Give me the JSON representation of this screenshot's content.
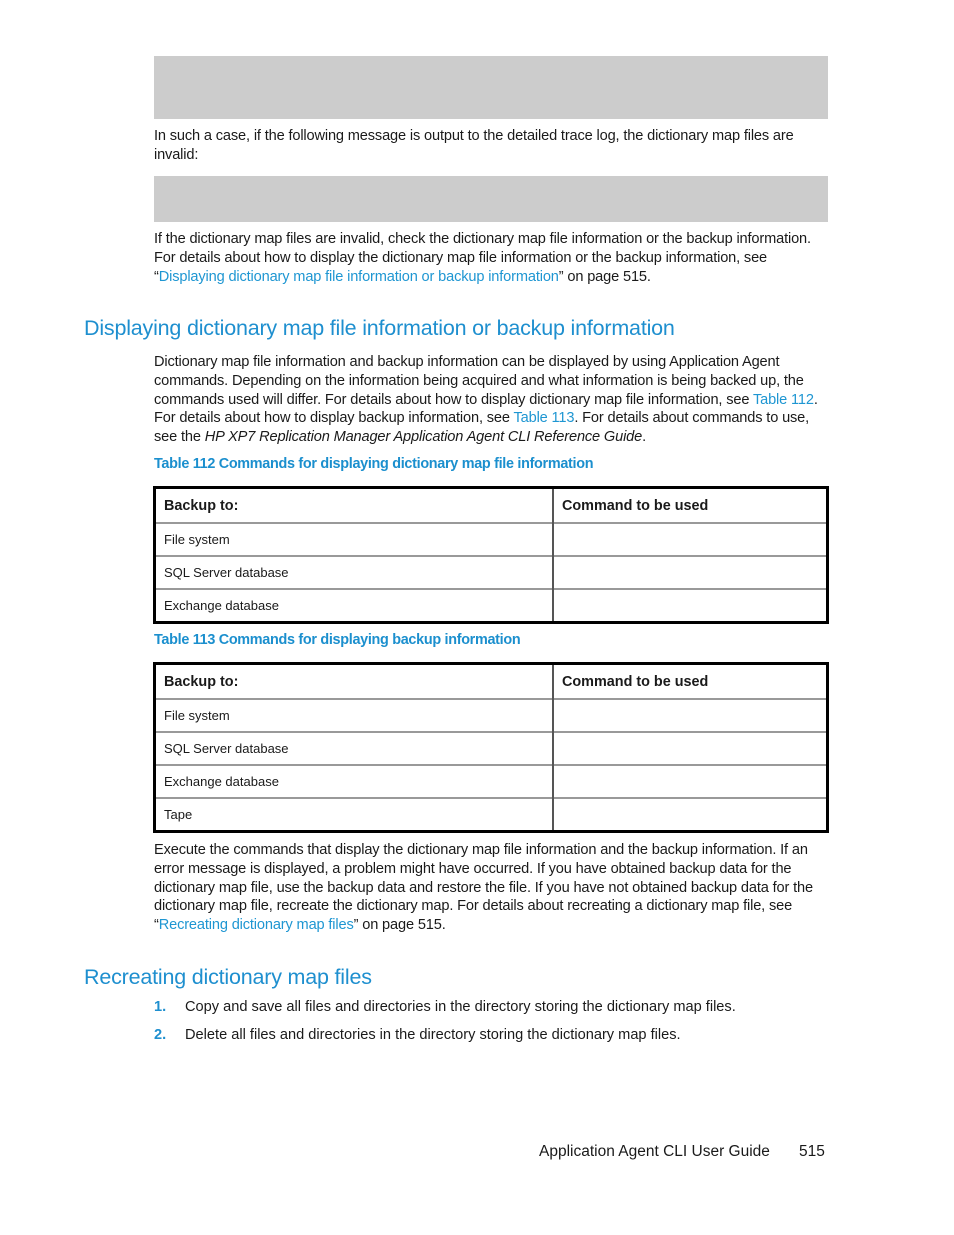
{
  "intro": {
    "case_text": "In such a case, if the following message is output to the detailed trace log, the dictionary map files are invalid:",
    "invalid_text_before": "If the dictionary map files are invalid, check the dictionary map file information or the backup information. For details about how to display the dictionary map file information or the backup information, see “",
    "invalid_link": "Displaying dictionary map file information or backup information",
    "invalid_text_after": "” on page 515."
  },
  "section1": {
    "heading": "Displaying dictionary map file information or backup information",
    "para_part1": "Dictionary map file information and backup information can be displayed by using Application Agent commands. Depending on the information being acquired and what information is being backed up, the commands used will differ. For details about how to display dictionary map file information, see ",
    "link_table112": "Table 112",
    "para_part2": ". For details about how to display backup information, see ",
    "link_table113": "Table 113",
    "para_part3": ". For details about commands to use, see the ",
    "para_italic": "HP XP7 Replication Manager Application Agent CLI Reference Guide",
    "para_part4": "."
  },
  "table112": {
    "caption": "Table 112 Commands for displaying dictionary map file information",
    "headers": [
      "Backup to:",
      "Command to be used"
    ],
    "rows": [
      [
        "File system",
        ""
      ],
      [
        "SQL Server database",
        ""
      ],
      [
        "Exchange database",
        ""
      ]
    ]
  },
  "table113": {
    "caption": "Table 113 Commands for displaying backup information",
    "headers": [
      "Backup to:",
      "Command to be used"
    ],
    "rows": [
      [
        "File system",
        ""
      ],
      [
        "SQL Server database",
        ""
      ],
      [
        "Exchange database",
        ""
      ],
      [
        "Tape",
        ""
      ]
    ]
  },
  "execute": {
    "text_before": "Execute the commands that display the dictionary map file information and the backup information. If an error message is displayed, a problem might have occurred. If you have obtained backup data for the dictionary map file, use the backup data and restore the file. If you have not obtained backup data for the dictionary map file, recreate the dictionary map. For details about recreating a dictionary map file, see “",
    "link": "Recreating dictionary map files",
    "text_after": "” on page 515."
  },
  "section2": {
    "heading": "Recreating dictionary map files",
    "steps": [
      {
        "num": "1.",
        "text": "Copy and save all files and directories in the directory storing the dictionary map files."
      },
      {
        "num": "2.",
        "text": "Delete all files and directories in the directory storing the dictionary map files."
      }
    ]
  },
  "footer": {
    "guide_title": "Application Agent CLI User Guide",
    "page_number": "515"
  }
}
